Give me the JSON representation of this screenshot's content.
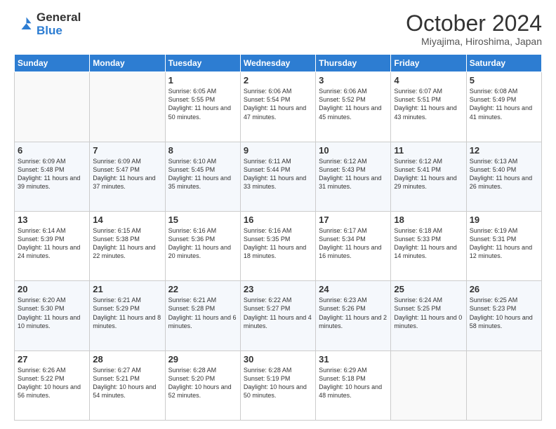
{
  "header": {
    "logo_line1": "General",
    "logo_line2": "Blue",
    "month": "October 2024",
    "location": "Miyajima, Hiroshima, Japan"
  },
  "weekdays": [
    "Sunday",
    "Monday",
    "Tuesday",
    "Wednesday",
    "Thursday",
    "Friday",
    "Saturday"
  ],
  "weeks": [
    [
      {
        "day": "",
        "text": ""
      },
      {
        "day": "",
        "text": ""
      },
      {
        "day": "1",
        "text": "Sunrise: 6:05 AM\nSunset: 5:55 PM\nDaylight: 11 hours and 50 minutes."
      },
      {
        "day": "2",
        "text": "Sunrise: 6:06 AM\nSunset: 5:54 PM\nDaylight: 11 hours and 47 minutes."
      },
      {
        "day": "3",
        "text": "Sunrise: 6:06 AM\nSunset: 5:52 PM\nDaylight: 11 hours and 45 minutes."
      },
      {
        "day": "4",
        "text": "Sunrise: 6:07 AM\nSunset: 5:51 PM\nDaylight: 11 hours and 43 minutes."
      },
      {
        "day": "5",
        "text": "Sunrise: 6:08 AM\nSunset: 5:49 PM\nDaylight: 11 hours and 41 minutes."
      }
    ],
    [
      {
        "day": "6",
        "text": "Sunrise: 6:09 AM\nSunset: 5:48 PM\nDaylight: 11 hours and 39 minutes."
      },
      {
        "day": "7",
        "text": "Sunrise: 6:09 AM\nSunset: 5:47 PM\nDaylight: 11 hours and 37 minutes."
      },
      {
        "day": "8",
        "text": "Sunrise: 6:10 AM\nSunset: 5:45 PM\nDaylight: 11 hours and 35 minutes."
      },
      {
        "day": "9",
        "text": "Sunrise: 6:11 AM\nSunset: 5:44 PM\nDaylight: 11 hours and 33 minutes."
      },
      {
        "day": "10",
        "text": "Sunrise: 6:12 AM\nSunset: 5:43 PM\nDaylight: 11 hours and 31 minutes."
      },
      {
        "day": "11",
        "text": "Sunrise: 6:12 AM\nSunset: 5:41 PM\nDaylight: 11 hours and 29 minutes."
      },
      {
        "day": "12",
        "text": "Sunrise: 6:13 AM\nSunset: 5:40 PM\nDaylight: 11 hours and 26 minutes."
      }
    ],
    [
      {
        "day": "13",
        "text": "Sunrise: 6:14 AM\nSunset: 5:39 PM\nDaylight: 11 hours and 24 minutes."
      },
      {
        "day": "14",
        "text": "Sunrise: 6:15 AM\nSunset: 5:38 PM\nDaylight: 11 hours and 22 minutes."
      },
      {
        "day": "15",
        "text": "Sunrise: 6:16 AM\nSunset: 5:36 PM\nDaylight: 11 hours and 20 minutes."
      },
      {
        "day": "16",
        "text": "Sunrise: 6:16 AM\nSunset: 5:35 PM\nDaylight: 11 hours and 18 minutes."
      },
      {
        "day": "17",
        "text": "Sunrise: 6:17 AM\nSunset: 5:34 PM\nDaylight: 11 hours and 16 minutes."
      },
      {
        "day": "18",
        "text": "Sunrise: 6:18 AM\nSunset: 5:33 PM\nDaylight: 11 hours and 14 minutes."
      },
      {
        "day": "19",
        "text": "Sunrise: 6:19 AM\nSunset: 5:31 PM\nDaylight: 11 hours and 12 minutes."
      }
    ],
    [
      {
        "day": "20",
        "text": "Sunrise: 6:20 AM\nSunset: 5:30 PM\nDaylight: 11 hours and 10 minutes."
      },
      {
        "day": "21",
        "text": "Sunrise: 6:21 AM\nSunset: 5:29 PM\nDaylight: 11 hours and 8 minutes."
      },
      {
        "day": "22",
        "text": "Sunrise: 6:21 AM\nSunset: 5:28 PM\nDaylight: 11 hours and 6 minutes."
      },
      {
        "day": "23",
        "text": "Sunrise: 6:22 AM\nSunset: 5:27 PM\nDaylight: 11 hours and 4 minutes."
      },
      {
        "day": "24",
        "text": "Sunrise: 6:23 AM\nSunset: 5:26 PM\nDaylight: 11 hours and 2 minutes."
      },
      {
        "day": "25",
        "text": "Sunrise: 6:24 AM\nSunset: 5:25 PM\nDaylight: 11 hours and 0 minutes."
      },
      {
        "day": "26",
        "text": "Sunrise: 6:25 AM\nSunset: 5:23 PM\nDaylight: 10 hours and 58 minutes."
      }
    ],
    [
      {
        "day": "27",
        "text": "Sunrise: 6:26 AM\nSunset: 5:22 PM\nDaylight: 10 hours and 56 minutes."
      },
      {
        "day": "28",
        "text": "Sunrise: 6:27 AM\nSunset: 5:21 PM\nDaylight: 10 hours and 54 minutes."
      },
      {
        "day": "29",
        "text": "Sunrise: 6:28 AM\nSunset: 5:20 PM\nDaylight: 10 hours and 52 minutes."
      },
      {
        "day": "30",
        "text": "Sunrise: 6:28 AM\nSunset: 5:19 PM\nDaylight: 10 hours and 50 minutes."
      },
      {
        "day": "31",
        "text": "Sunrise: 6:29 AM\nSunset: 5:18 PM\nDaylight: 10 hours and 48 minutes."
      },
      {
        "day": "",
        "text": ""
      },
      {
        "day": "",
        "text": ""
      }
    ]
  ]
}
